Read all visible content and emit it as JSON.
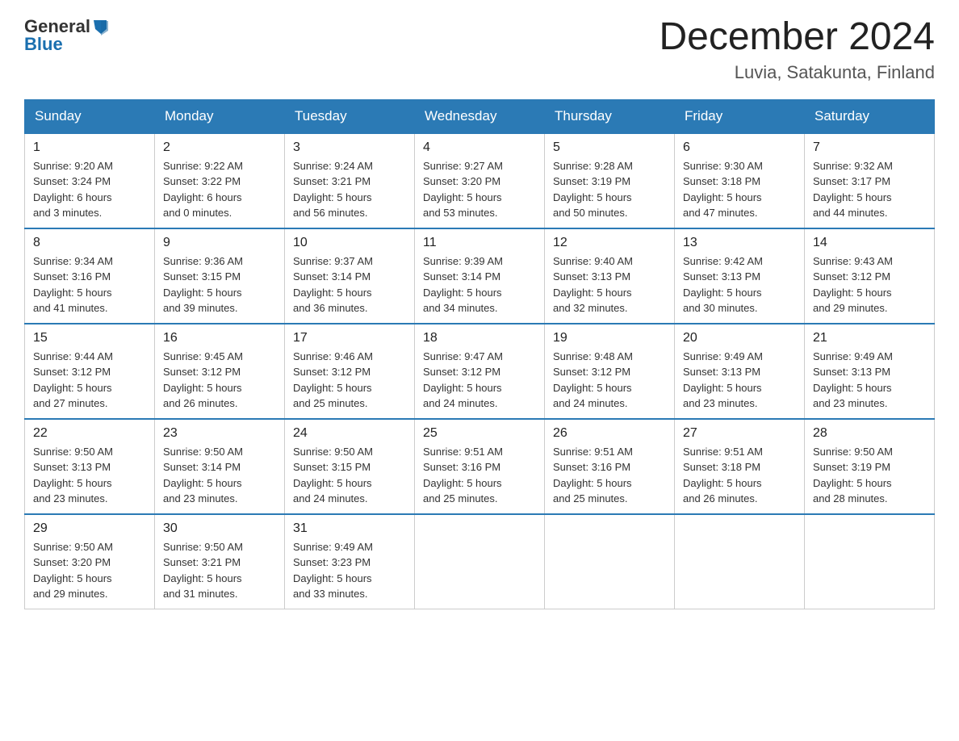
{
  "header": {
    "logo": {
      "text_general": "General",
      "text_blue": "Blue",
      "aria_label": "GeneralBlue logo"
    },
    "month_title": "December 2024",
    "location": "Luvia, Satakunta, Finland"
  },
  "calendar": {
    "weekdays": [
      "Sunday",
      "Monday",
      "Tuesday",
      "Wednesday",
      "Thursday",
      "Friday",
      "Saturday"
    ],
    "weeks": [
      [
        {
          "day": "1",
          "sunrise": "9:20 AM",
          "sunset": "3:24 PM",
          "daylight": "6 hours and 3 minutes."
        },
        {
          "day": "2",
          "sunrise": "9:22 AM",
          "sunset": "3:22 PM",
          "daylight": "6 hours and 0 minutes."
        },
        {
          "day": "3",
          "sunrise": "9:24 AM",
          "sunset": "3:21 PM",
          "daylight": "5 hours and 56 minutes."
        },
        {
          "day": "4",
          "sunrise": "9:27 AM",
          "sunset": "3:20 PM",
          "daylight": "5 hours and 53 minutes."
        },
        {
          "day": "5",
          "sunrise": "9:28 AM",
          "sunset": "3:19 PM",
          "daylight": "5 hours and 50 minutes."
        },
        {
          "day": "6",
          "sunrise": "9:30 AM",
          "sunset": "3:18 PM",
          "daylight": "5 hours and 47 minutes."
        },
        {
          "day": "7",
          "sunrise": "9:32 AM",
          "sunset": "3:17 PM",
          "daylight": "5 hours and 44 minutes."
        }
      ],
      [
        {
          "day": "8",
          "sunrise": "9:34 AM",
          "sunset": "3:16 PM",
          "daylight": "5 hours and 41 minutes."
        },
        {
          "day": "9",
          "sunrise": "9:36 AM",
          "sunset": "3:15 PM",
          "daylight": "5 hours and 39 minutes."
        },
        {
          "day": "10",
          "sunrise": "9:37 AM",
          "sunset": "3:14 PM",
          "daylight": "5 hours and 36 minutes."
        },
        {
          "day": "11",
          "sunrise": "9:39 AM",
          "sunset": "3:14 PM",
          "daylight": "5 hours and 34 minutes."
        },
        {
          "day": "12",
          "sunrise": "9:40 AM",
          "sunset": "3:13 PM",
          "daylight": "5 hours and 32 minutes."
        },
        {
          "day": "13",
          "sunrise": "9:42 AM",
          "sunset": "3:13 PM",
          "daylight": "5 hours and 30 minutes."
        },
        {
          "day": "14",
          "sunrise": "9:43 AM",
          "sunset": "3:12 PM",
          "daylight": "5 hours and 29 minutes."
        }
      ],
      [
        {
          "day": "15",
          "sunrise": "9:44 AM",
          "sunset": "3:12 PM",
          "daylight": "5 hours and 27 minutes."
        },
        {
          "day": "16",
          "sunrise": "9:45 AM",
          "sunset": "3:12 PM",
          "daylight": "5 hours and 26 minutes."
        },
        {
          "day": "17",
          "sunrise": "9:46 AM",
          "sunset": "3:12 PM",
          "daylight": "5 hours and 25 minutes."
        },
        {
          "day": "18",
          "sunrise": "9:47 AM",
          "sunset": "3:12 PM",
          "daylight": "5 hours and 24 minutes."
        },
        {
          "day": "19",
          "sunrise": "9:48 AM",
          "sunset": "3:12 PM",
          "daylight": "5 hours and 24 minutes."
        },
        {
          "day": "20",
          "sunrise": "9:49 AM",
          "sunset": "3:13 PM",
          "daylight": "5 hours and 23 minutes."
        },
        {
          "day": "21",
          "sunrise": "9:49 AM",
          "sunset": "3:13 PM",
          "daylight": "5 hours and 23 minutes."
        }
      ],
      [
        {
          "day": "22",
          "sunrise": "9:50 AM",
          "sunset": "3:13 PM",
          "daylight": "5 hours and 23 minutes."
        },
        {
          "day": "23",
          "sunrise": "9:50 AM",
          "sunset": "3:14 PM",
          "daylight": "5 hours and 23 minutes."
        },
        {
          "day": "24",
          "sunrise": "9:50 AM",
          "sunset": "3:15 PM",
          "daylight": "5 hours and 24 minutes."
        },
        {
          "day": "25",
          "sunrise": "9:51 AM",
          "sunset": "3:16 PM",
          "daylight": "5 hours and 25 minutes."
        },
        {
          "day": "26",
          "sunrise": "9:51 AM",
          "sunset": "3:16 PM",
          "daylight": "5 hours and 25 minutes."
        },
        {
          "day": "27",
          "sunrise": "9:51 AM",
          "sunset": "3:18 PM",
          "daylight": "5 hours and 26 minutes."
        },
        {
          "day": "28",
          "sunrise": "9:50 AM",
          "sunset": "3:19 PM",
          "daylight": "5 hours and 28 minutes."
        }
      ],
      [
        {
          "day": "29",
          "sunrise": "9:50 AM",
          "sunset": "3:20 PM",
          "daylight": "5 hours and 29 minutes."
        },
        {
          "day": "30",
          "sunrise": "9:50 AM",
          "sunset": "3:21 PM",
          "daylight": "5 hours and 31 minutes."
        },
        {
          "day": "31",
          "sunrise": "9:49 AM",
          "sunset": "3:23 PM",
          "daylight": "5 hours and 33 minutes."
        },
        null,
        null,
        null,
        null
      ]
    ],
    "labels": {
      "sunrise": "Sunrise:",
      "sunset": "Sunset:",
      "daylight": "Daylight:"
    }
  }
}
